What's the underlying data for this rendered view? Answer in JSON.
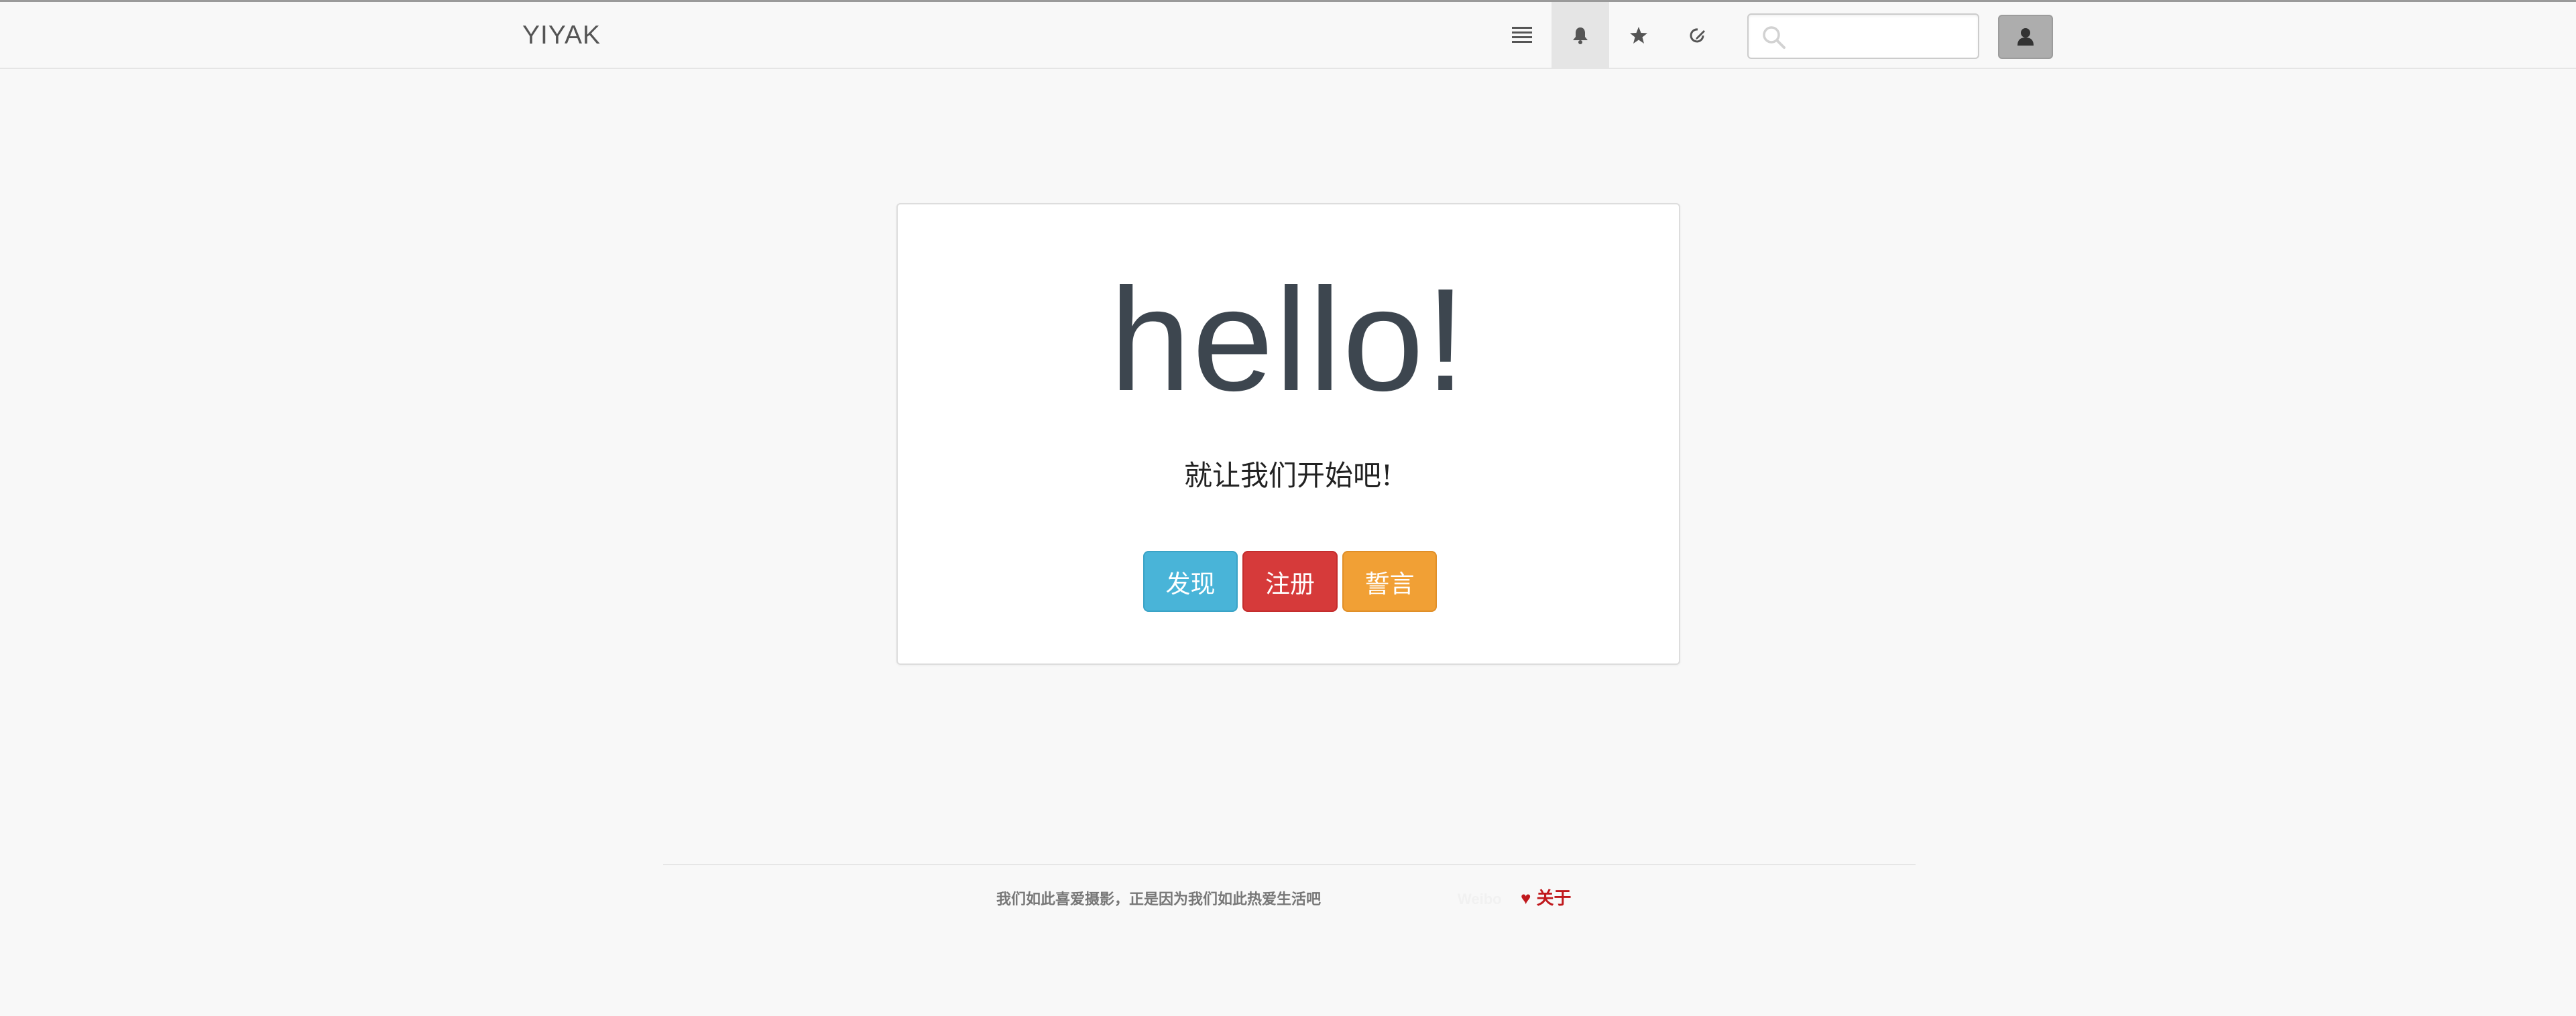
{
  "navbar": {
    "brand": "YIYAK",
    "icons": [
      "list-icon",
      "bell-icon",
      "star-icon",
      "edit-icon"
    ],
    "search": {
      "placeholder": "",
      "value": ""
    },
    "user_icon": "user-icon"
  },
  "hero": {
    "title": "hello!",
    "subtitle": "就让我们开始吧!",
    "buttons": [
      {
        "label": "发现",
        "color": "#49b4d8"
      },
      {
        "label": "注册",
        "color": "#d63a3a"
      },
      {
        "label": "誓言",
        "color": "#f1a035"
      }
    ]
  },
  "footer": {
    "tagline": "我们如此喜爱摄影，正是因为我们如此热爱生活吧",
    "faint_text": "Weibo",
    "about_heart": "♥",
    "about_label": "关于",
    "accent_color": "#c0191d"
  }
}
